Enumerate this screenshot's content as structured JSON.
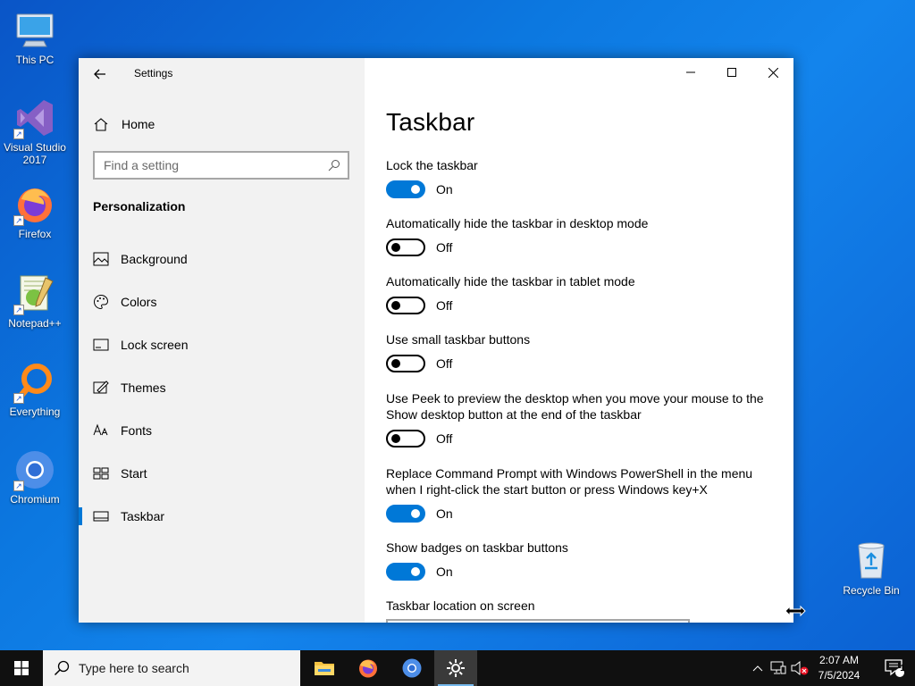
{
  "desktop": {
    "icons": [
      {
        "label": "This PC",
        "icon": "computer-icon"
      },
      {
        "label": "Visual Studio 2017",
        "icon": "visual-studio-icon"
      },
      {
        "label": "Firefox",
        "icon": "firefox-icon"
      },
      {
        "label": "Notepad++",
        "icon": "notepadpp-icon"
      },
      {
        "label": "Everything",
        "icon": "everything-icon"
      },
      {
        "label": "Chromium",
        "icon": "chromium-icon"
      }
    ],
    "recycle_bin": "Recycle Bin"
  },
  "window": {
    "title": "Settings",
    "sidebar": {
      "home_label": "Home",
      "search_placeholder": "Find a setting",
      "section_heading": "Personalization",
      "items": [
        {
          "label": "Background",
          "icon": "image-icon"
        },
        {
          "label": "Colors",
          "icon": "palette-icon"
        },
        {
          "label": "Lock screen",
          "icon": "lock-screen-icon"
        },
        {
          "label": "Themes",
          "icon": "themes-icon"
        },
        {
          "label": "Fonts",
          "icon": "fonts-icon"
        },
        {
          "label": "Start",
          "icon": "start-layout-icon"
        },
        {
          "label": "Taskbar",
          "icon": "taskbar-icon",
          "active": true
        }
      ]
    },
    "content": {
      "title": "Taskbar",
      "settings": [
        {
          "label": "Lock the taskbar",
          "state": "On",
          "on": true
        },
        {
          "label": "Automatically hide the taskbar in desktop mode",
          "state": "Off",
          "on": false
        },
        {
          "label": "Automatically hide the taskbar in tablet mode",
          "state": "Off",
          "on": false
        },
        {
          "label": "Use small taskbar buttons",
          "state": "Off",
          "on": false
        },
        {
          "label": "Use Peek to preview the desktop when you move your mouse to the Show desktop button at the end of the taskbar",
          "state": "Off",
          "on": false
        },
        {
          "label": "Replace Command Prompt with Windows PowerShell in the menu when I right-click the start button or press Windows key+X",
          "state": "On",
          "on": true
        },
        {
          "label": "Show badges on taskbar buttons",
          "state": "On",
          "on": true
        }
      ],
      "location_label": "Taskbar location on screen"
    }
  },
  "taskbar": {
    "search_placeholder": "Type here to search",
    "apps": [
      "file-explorer-icon",
      "firefox-icon",
      "chromium-icon",
      "settings-gear-icon"
    ],
    "time": "2:07 AM",
    "date": "7/5/2024",
    "notification_count": "1"
  },
  "colors": {
    "accent": "#0078d7",
    "taskbar": "#101010",
    "sidebar": "#f2f2f2"
  }
}
